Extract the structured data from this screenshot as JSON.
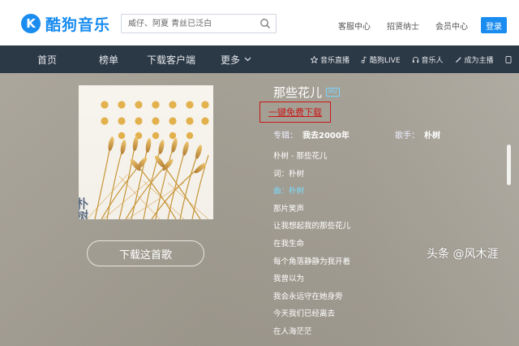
{
  "header": {
    "logo_text": "酷狗音乐",
    "logo_badge": "K",
    "search_placeholder": "威仔、阿夏 青丝已泛白",
    "links": [
      "客服中心",
      "招贤纳士",
      "会员中心"
    ],
    "login_label": "登录",
    "brand_color": "#1a8cf0"
  },
  "nav": {
    "items": [
      "首页",
      "榜单",
      "下载客户端",
      "更多"
    ],
    "right": [
      {
        "icon": "star-icon",
        "label": "音乐直播"
      },
      {
        "icon": "note-icon",
        "label": "酷狗LIVE"
      },
      {
        "icon": "headphones-icon",
        "label": "音乐人"
      },
      {
        "icon": "pen-icon",
        "label": "成为主播"
      }
    ]
  },
  "song": {
    "title": "那些花儿",
    "mv_badge": "MV",
    "free_download": "一键免费下载",
    "album_label": "专辑：",
    "album": "我去2000年",
    "singer_label": "歌手：",
    "singer": "朴树",
    "download_button": "下载这首歌",
    "cover_artist_text": "朴树"
  },
  "lyrics": [
    "朴树 - 那些花儿",
    "词：朴树",
    "曲：朴树",
    "那片笑声",
    "让我想起我的那些花儿",
    "在我生命",
    "每个角落静静为我开着",
    "我曾以为",
    "我会永远守在她身旁",
    "今天我们已经离去",
    "在人海茫茫"
  ],
  "active_lyric_index": 2,
  "watermark": "头条 @风木涯"
}
